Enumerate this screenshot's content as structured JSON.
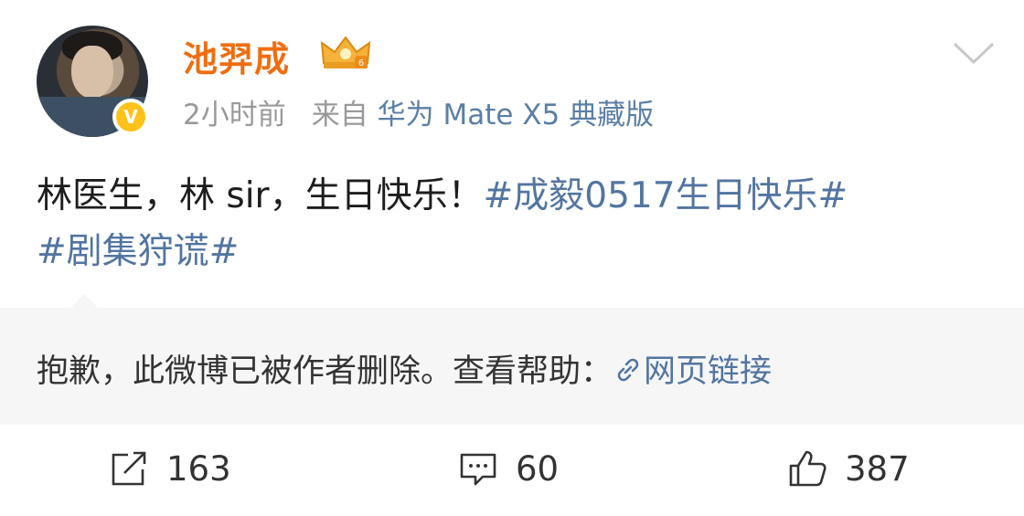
{
  "post": {
    "username": "池羿成",
    "verified_badge": "V",
    "time": "2小时前",
    "source_prefix": "来自",
    "source": "华为 Mate X5 典藏版",
    "text_plain": "林医生，林 sir，生日快乐！",
    "tags": [
      "#成毅0517生日快乐#",
      "#剧集狩谎#"
    ]
  },
  "retweet": {
    "message": "抱歉，此微博已被作者删除。查看帮助：",
    "link_label": "网页链接"
  },
  "actions": {
    "repost_count": "163",
    "comment_count": "60",
    "like_count": "387"
  },
  "icons": {
    "crown": "crown-icon",
    "more": "chevron-down-icon",
    "link": "link-icon",
    "repost": "repost-icon",
    "comment": "comment-icon",
    "like": "thumbs-up-icon"
  },
  "colors": {
    "username": "#f06d0f",
    "link": "#5275a1",
    "meta": "#999999",
    "retweet_bg": "#f6f6f6",
    "badge": "#ffc21a"
  }
}
